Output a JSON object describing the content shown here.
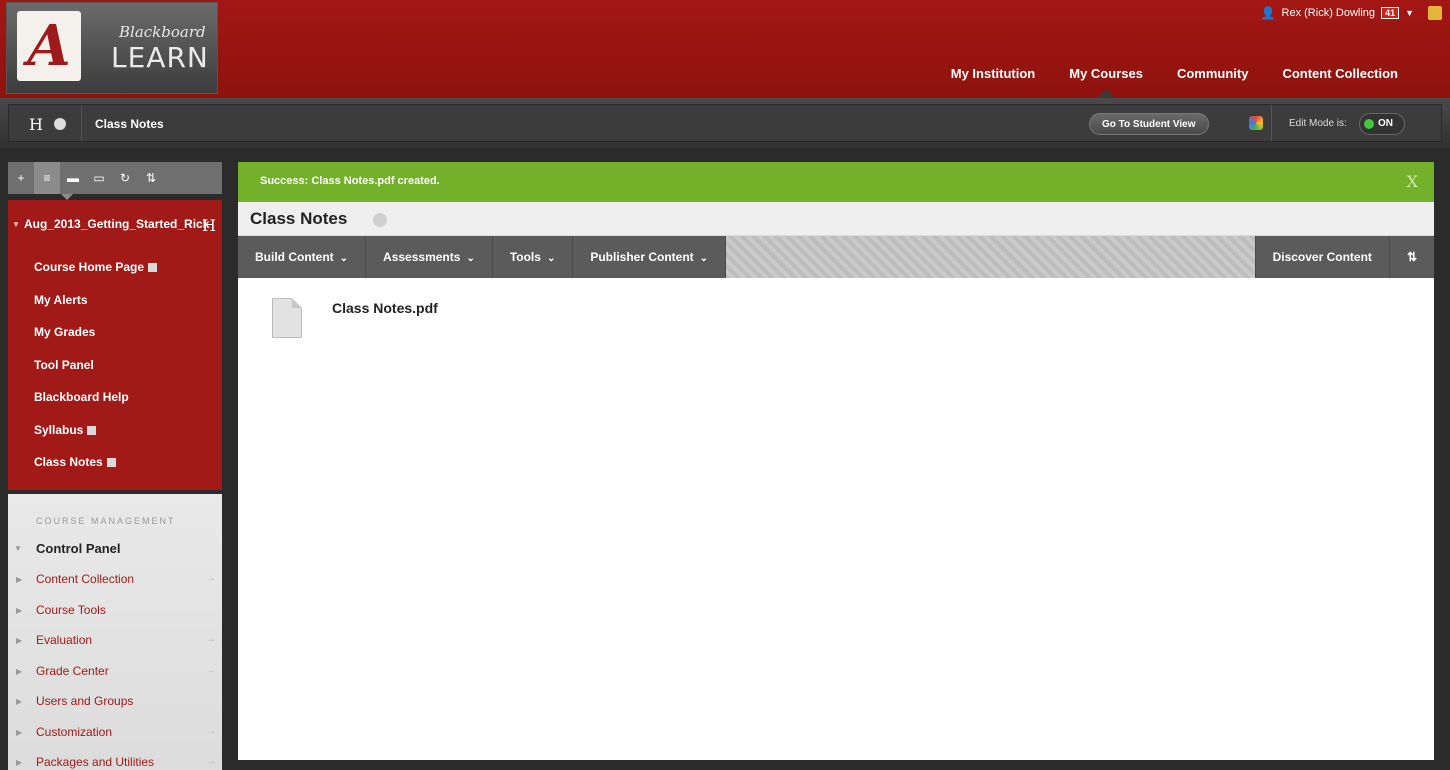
{
  "header": {
    "logo_line1": "Blackboard",
    "logo_line2": "LEARN",
    "logo_letter": "A",
    "user_name": "Rex (Rick) Dowling",
    "notification_count": "41",
    "nav": [
      "My Institution",
      "My Courses",
      "Community",
      "Content Collection"
    ],
    "active_nav": "My Courses"
  },
  "breadcrumb": {
    "home_symbol": "H",
    "title": "Class Notes",
    "student_view_label": "Go To Student View",
    "edit_mode_label": "Edit Mode is:",
    "edit_mode_value": "ON"
  },
  "sidebar": {
    "toolbar": [
      "+",
      "≡",
      "▬",
      "▭",
      "↻",
      "⇅"
    ],
    "course_title": "Aug_2013_Getting_Started_Rick",
    "course_title_symbol": "H",
    "links": [
      {
        "label": "Course Home Page",
        "icon": true
      },
      {
        "label": "My Alerts",
        "icon": false
      },
      {
        "label": "My Grades",
        "icon": false
      },
      {
        "label": "Tool Panel",
        "icon": false
      },
      {
        "label": "Blackboard Help",
        "icon": false
      },
      {
        "label": "Syllabus",
        "icon": true
      },
      {
        "label": "Class Notes",
        "icon": true
      }
    ],
    "management_label": "COURSE MANAGEMENT",
    "control_panel": "Control Panel",
    "control_items": [
      "Content Collection",
      "Course Tools",
      "Evaluation",
      "Grade Center",
      "Users and Groups",
      "Customization",
      "Packages and Utilities"
    ]
  },
  "main": {
    "success_message": "Success: Class Notes.pdf created.",
    "close_symbol": "X",
    "page_title": "Class Notes",
    "action_buttons": [
      "Build Content",
      "Assessments",
      "Tools",
      "Publisher Content"
    ],
    "discover_label": "Discover Content",
    "sort_symbol": "⇅",
    "item_title": "Class Notes.pdf"
  },
  "colors": {
    "brand_red": "#a21a17",
    "success_green": "#74b12a",
    "toggle_on": "#41c93a"
  }
}
